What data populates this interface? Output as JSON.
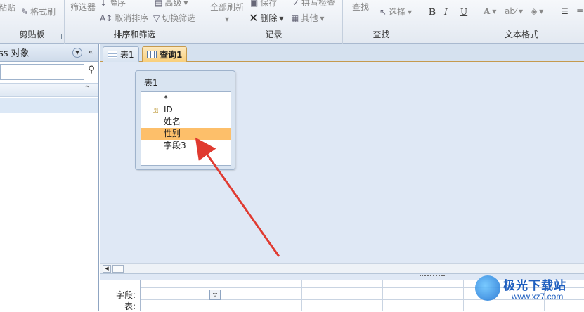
{
  "ribbon": {
    "clipboard": {
      "paste": "粘贴",
      "format_painter": "格式刷",
      "title": "剪贴板"
    },
    "sort_filter": {
      "filter": "筛选器",
      "ascending": "降序",
      "remove_sort": "取消排序",
      "advanced": "高级",
      "toggle_filter": "切换筛选",
      "title": "排序和筛选"
    },
    "records": {
      "refresh_all": "全部刷新",
      "save": "保存",
      "spelling": "拼写检查",
      "delete": "删除",
      "more": "其他",
      "title": "记录"
    },
    "find": {
      "find": "查找",
      "select": "选择",
      "title": "查找"
    },
    "text_format": {
      "bold": "B",
      "italic": "I",
      "underline": "U",
      "title": "文本格式"
    }
  },
  "nav": {
    "title": "ss 对象",
    "search_placeholder": ""
  },
  "tabs": [
    {
      "label": "表1",
      "icon": "table-icon",
      "active": false
    },
    {
      "label": "查询1",
      "icon": "query-icon",
      "active": true
    }
  ],
  "table_box": {
    "title": "表1",
    "fields": [
      {
        "label": "*",
        "key": false,
        "selected": false
      },
      {
        "label": "ID",
        "key": true,
        "selected": false
      },
      {
        "label": "姓名",
        "key": false,
        "selected": false
      },
      {
        "label": "性别",
        "key": false,
        "selected": true
      },
      {
        "label": "字段3",
        "key": false,
        "selected": false
      }
    ]
  },
  "grid": {
    "row_labels": {
      "field": "字段:",
      "table": "表:"
    }
  },
  "watermark": {
    "brand": "极光下载站",
    "url": "www.xz7.com"
  },
  "colors": {
    "accent": "#f9cf7b",
    "selected_field": "#fdbf6a",
    "arrow": "#e03a30",
    "workspace": "#dfe8f5"
  }
}
